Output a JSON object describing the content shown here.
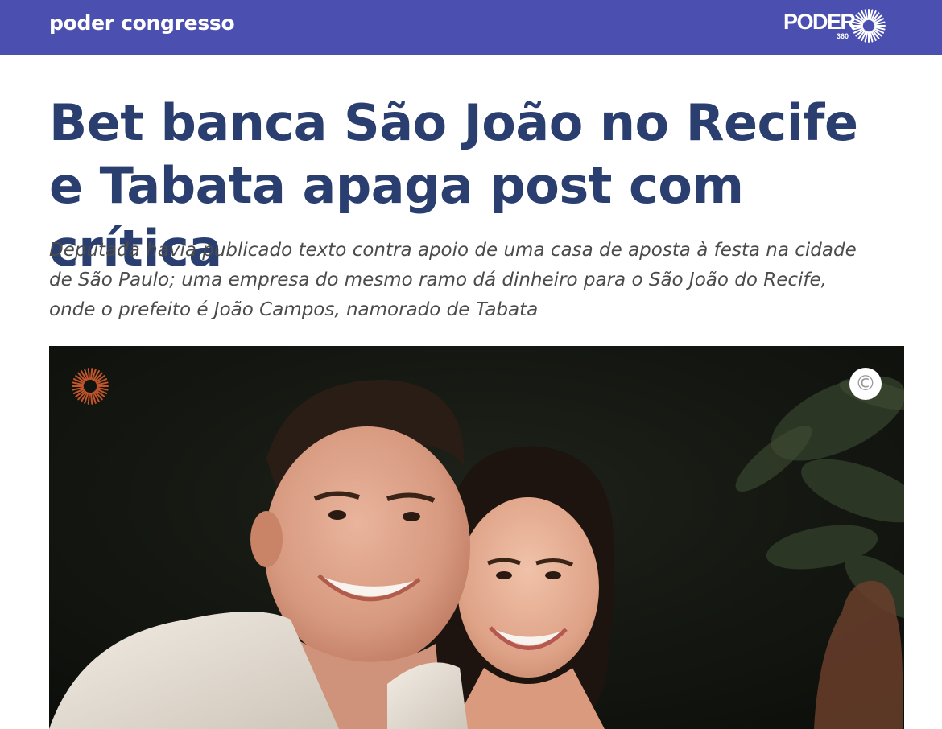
{
  "header": {
    "section_label": "poder congresso",
    "brand": {
      "word": "PODER",
      "sub": "360"
    },
    "bar_color": "#4a4fb0"
  },
  "article": {
    "headline": "Bet banca São João no Recife e Tabata apaga post com crítica",
    "subheadline": "Deputada havia publicado texto contra apoio de uma casa de aposta à festa na cidade de São Paulo; uma empresa do mesmo ramo dá dinheiro para o São João do Recife, onde o prefeito é João Campos, namorado de Tabata",
    "headline_color": "#2a3f70"
  },
  "photo": {
    "watermark_icon": "poder360-burst-icon",
    "rights_icon": "copyright-icon",
    "rights_symbol": "©"
  }
}
